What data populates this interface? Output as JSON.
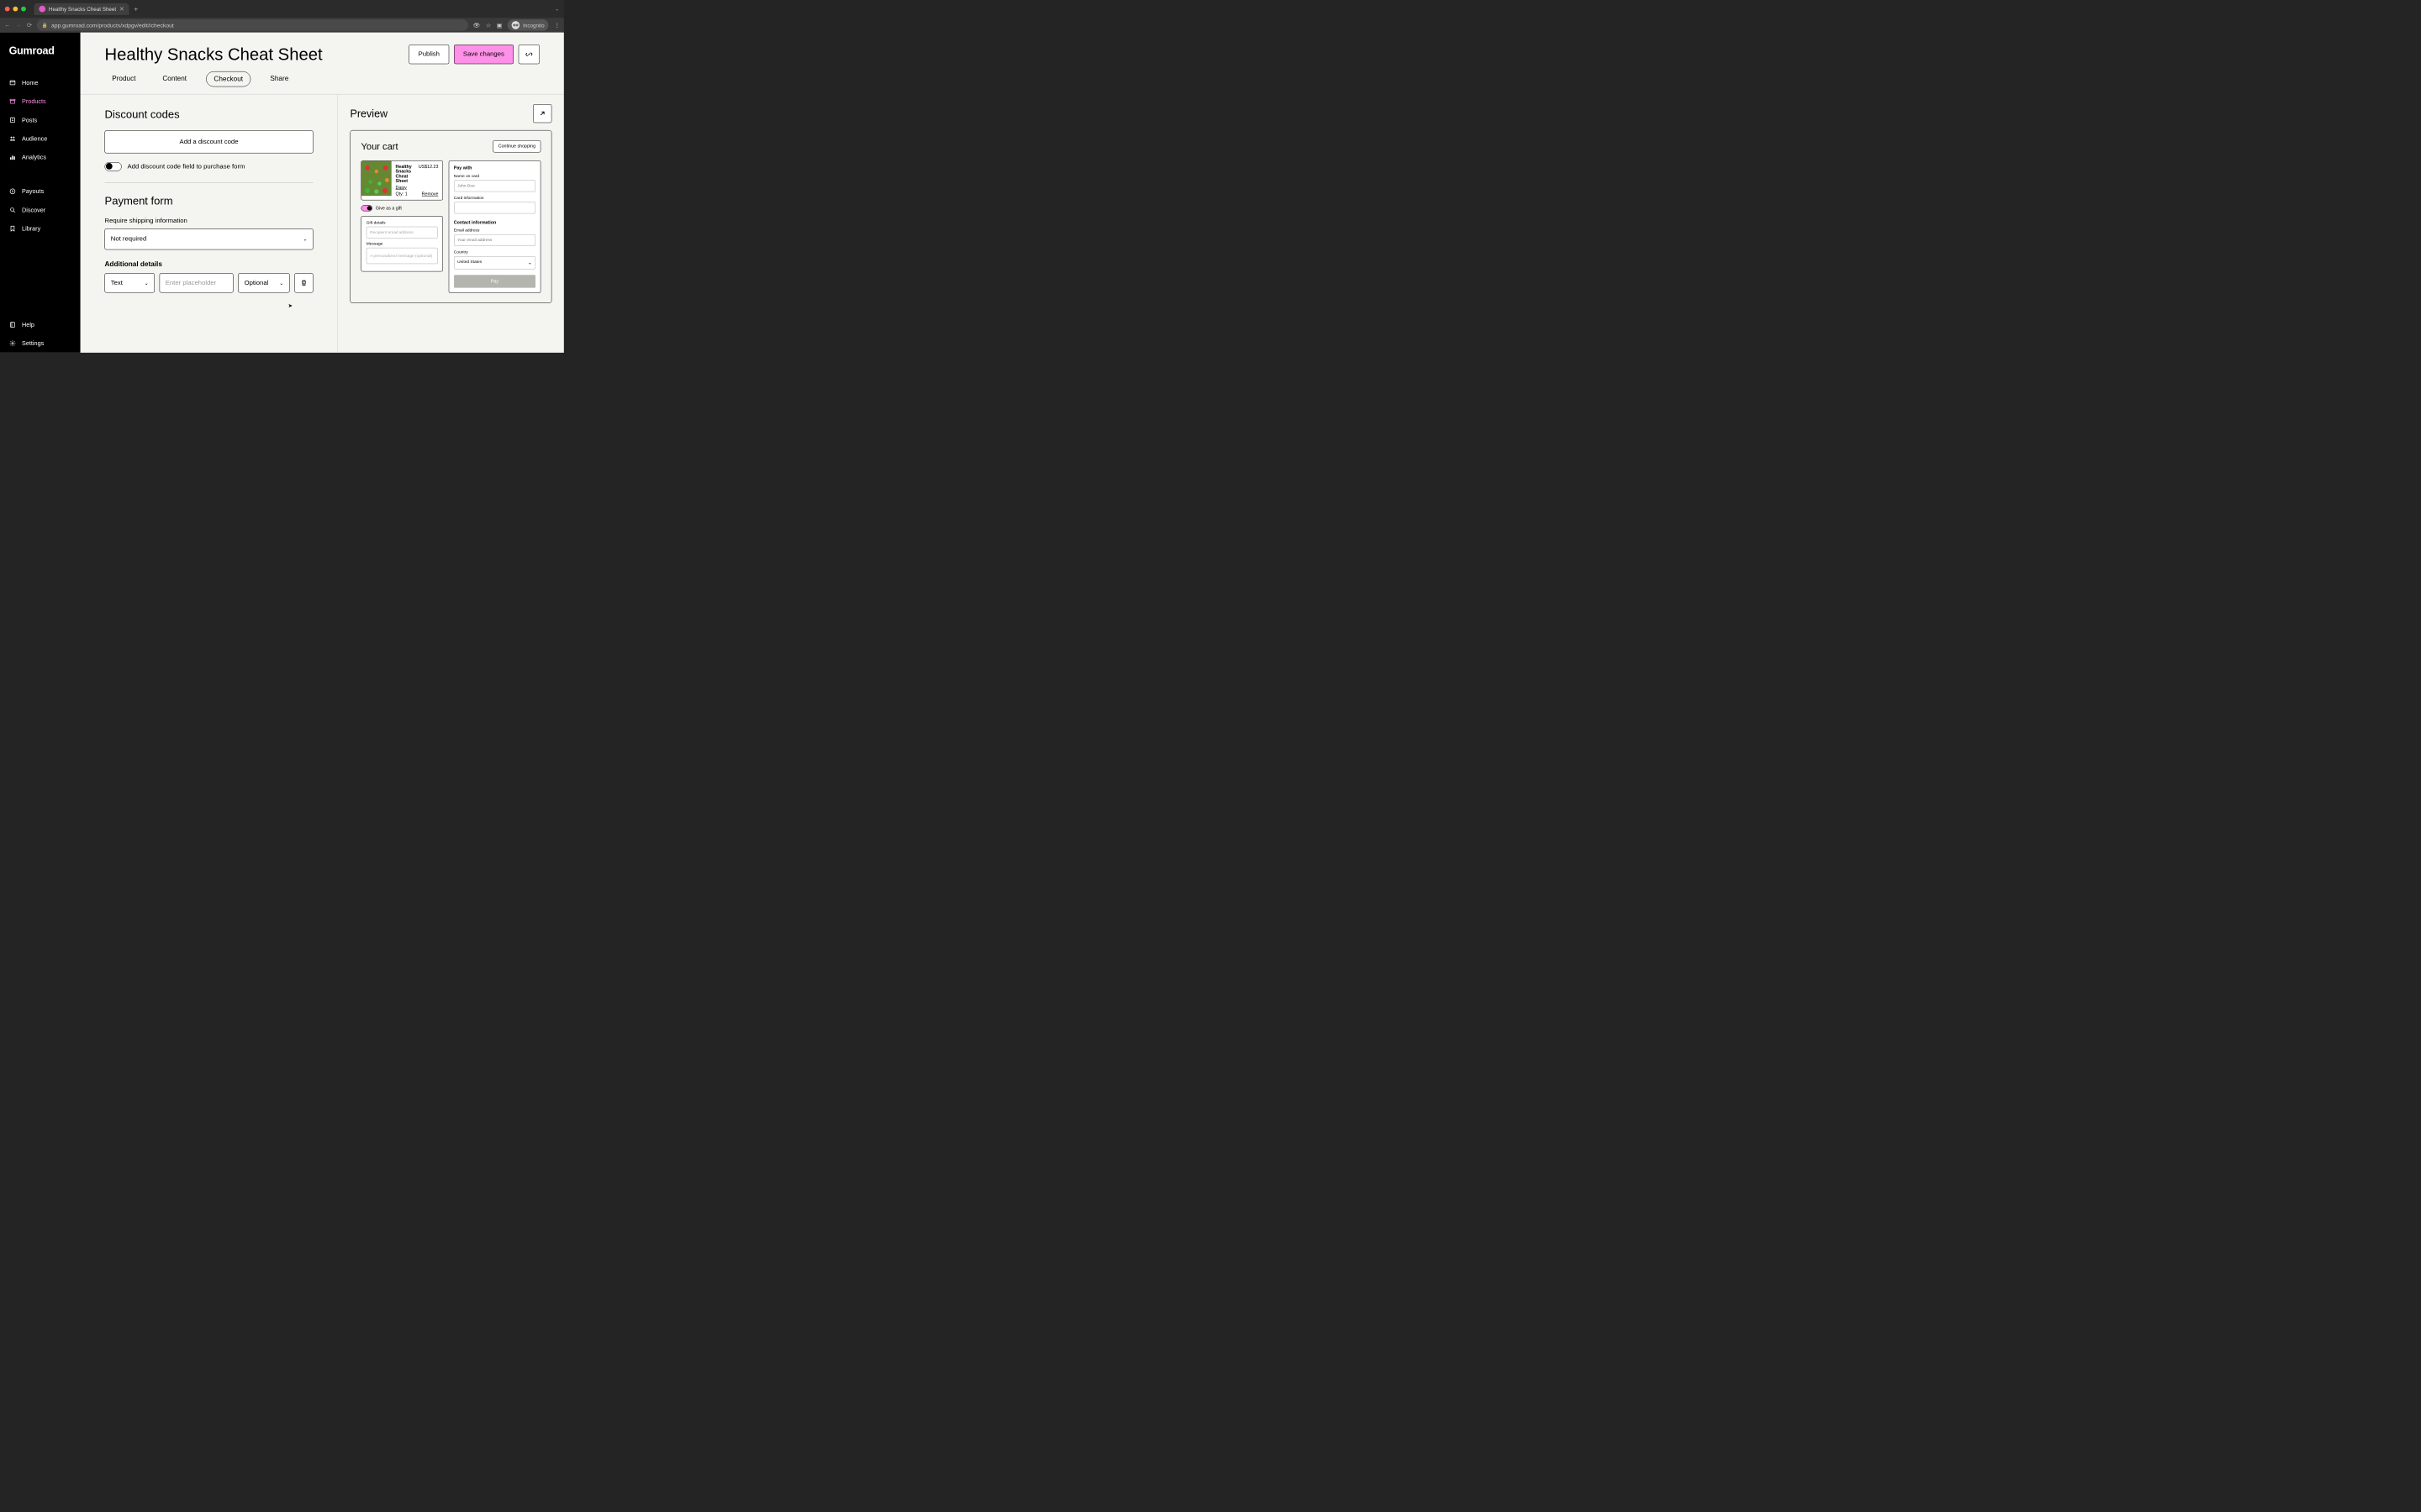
{
  "browser": {
    "tab_title": "Healthy Snacks Cheat Sheet",
    "url": "app.gumroad.com/products/xdpgv/edit#checkout",
    "incognito_label": "Incognito"
  },
  "sidebar": {
    "logo": "Gumroad",
    "items": [
      {
        "label": "Home"
      },
      {
        "label": "Products"
      },
      {
        "label": "Posts"
      },
      {
        "label": "Audience"
      },
      {
        "label": "Analytics"
      },
      {
        "label": "Payouts"
      },
      {
        "label": "Discover"
      },
      {
        "label": "Library"
      },
      {
        "label": "Help"
      },
      {
        "label": "Settings"
      }
    ]
  },
  "header": {
    "title": "Healthy Snacks Cheat Sheet",
    "publish": "Publish",
    "save": "Save changes"
  },
  "tabs": [
    {
      "label": "Product"
    },
    {
      "label": "Content"
    },
    {
      "label": "Checkout"
    },
    {
      "label": "Share"
    }
  ],
  "checkout": {
    "discount_heading": "Discount codes",
    "add_discount": "Add a discount code",
    "toggle_label": "Add discount code field to purchase form",
    "payment_heading": "Payment form",
    "shipping_label": "Require shipping information",
    "shipping_value": "Not required",
    "additional_label": "Additional details",
    "detail_type": "Text",
    "detail_placeholder": "Enter placeholder",
    "detail_optional": "Optional"
  },
  "preview": {
    "heading": "Preview",
    "cart_title": "Your cart",
    "continue": "Continue shopping",
    "product": {
      "name": "Healthy Snacks Cheat Sheet",
      "price": "US$12.23",
      "author": "Daisy",
      "qty": "Qty: 1",
      "remove": "Remove"
    },
    "gift": {
      "toggle_label": "Give as a gift",
      "details_label": "Gift details",
      "recipient_placeholder": "Recipient email address",
      "message_label": "Message",
      "message_placeholder": "A personalized message (optional)"
    },
    "pay": {
      "pay_with": "Pay with",
      "name_label": "Name on card",
      "name_placeholder": "John Doe",
      "card_label": "Card information",
      "contact_label": "Contact information",
      "email_label": "Email address",
      "email_placeholder": "Your email address",
      "country_label": "Country",
      "country_value": "United States",
      "pay_button": "Pay"
    }
  }
}
